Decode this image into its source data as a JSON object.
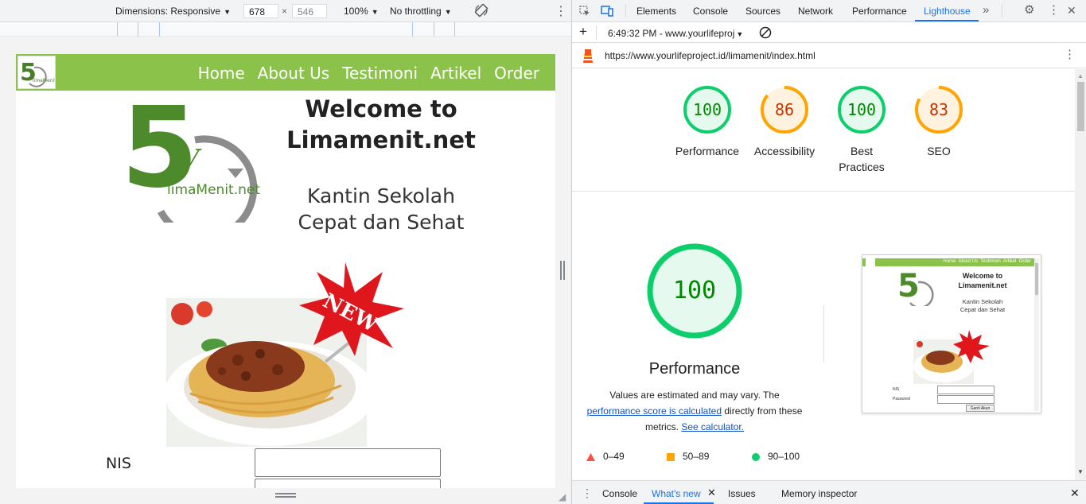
{
  "emulation": {
    "dimensions_label": "Dimensions: Responsive",
    "width": "678",
    "height": "546",
    "times": "×",
    "zoom": "100%",
    "throttling": "No throttling"
  },
  "site": {
    "nav_items": [
      "Home",
      "About Us",
      "Testimoni",
      "Artikel",
      "Order"
    ],
    "logo_text": "limaMenit.net",
    "welcome_line1": "Welcome to",
    "welcome_line2": "Limamenit.net",
    "tagline_line1": "Kantin Sekolah",
    "tagline_line2": "Cepat dan Sehat",
    "badge_text": "NEW",
    "form_label_nis": "NIS"
  },
  "devtools": {
    "tabs": [
      "Elements",
      "Console",
      "Sources",
      "Network",
      "Performance",
      "Lighthouse"
    ],
    "active_tab": "Lighthouse",
    "report_selector": "6:49:32 PM - www.yourlifeproj",
    "url": "https://www.yourlifeproject.id/limamenit/index.html",
    "scores": [
      {
        "label": "Performance",
        "value": 100,
        "color": "#0cce6b",
        "text_color": "#008800",
        "bg": "#e6f9ef"
      },
      {
        "label": "Accessibility",
        "value": 86,
        "color": "#ffa400",
        "text_color": "#c33300",
        "bg": "#fff3e0"
      },
      {
        "label": "Best Practices",
        "value": 100,
        "color": "#0cce6b",
        "text_color": "#008800",
        "bg": "#e6f9ef"
      },
      {
        "label": "SEO",
        "value": 83,
        "color": "#ffa400",
        "text_color": "#c33300",
        "bg": "#fff3e0"
      }
    ],
    "detail_score": "100",
    "detail_title": "Performance",
    "note_before": "Values are estimated and may vary. The",
    "note_link1": "performance score is calculated",
    "note_mid": "directly from these metrics.",
    "note_link2": "See calculator.",
    "legend": [
      {
        "range": "0–49",
        "color": "#ff4e42",
        "shape": "triangle"
      },
      {
        "range": "50–89",
        "color": "#ffa400",
        "shape": "square"
      },
      {
        "range": "90–100",
        "color": "#0cce6b",
        "shape": "circle"
      }
    ],
    "thumb": {
      "nav": "Home  About Us  Testimoni  Artikel  Order",
      "welcome1": "Welcome to",
      "welcome2": "Limamenit.net",
      "tag1": "Kantin Sekolah",
      "tag2": "Cepat dan Sehat",
      "nis": "NIS",
      "password": "Password",
      "button": "Ganti Akun"
    },
    "drawer_tabs": [
      "Console",
      "What's new",
      "Issues",
      "Memory inspector"
    ],
    "drawer_active": "What's new"
  }
}
